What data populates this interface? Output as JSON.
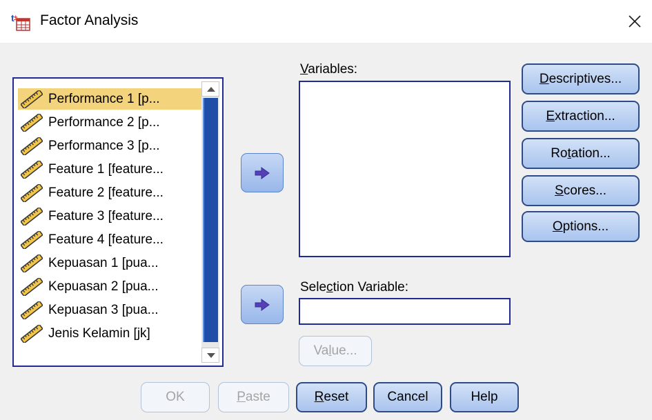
{
  "window": {
    "title": "Factor Analysis",
    "app_icon": "spss-table-icon",
    "close_glyph": "×"
  },
  "variables_list": [
    {
      "label": "Performance 1 [p...",
      "icon": "scale-ruler-icon",
      "selected": true
    },
    {
      "label": "Performance 2 [p...",
      "icon": "scale-ruler-icon",
      "selected": false
    },
    {
      "label": "Performance 3 [p...",
      "icon": "scale-ruler-icon",
      "selected": false
    },
    {
      "label": "Feature 1 [feature...",
      "icon": "scale-ruler-icon",
      "selected": false
    },
    {
      "label": "Feature 2 [feature...",
      "icon": "scale-ruler-icon",
      "selected": false
    },
    {
      "label": "Feature 3 [feature...",
      "icon": "scale-ruler-icon",
      "selected": false
    },
    {
      "label": "Feature 4 [feature...",
      "icon": "scale-ruler-icon",
      "selected": false
    },
    {
      "label": "Kepuasan 1 [pua...",
      "icon": "scale-ruler-icon",
      "selected": false
    },
    {
      "label": "Kepuasan 2 [pua...",
      "icon": "scale-ruler-icon",
      "selected": false
    },
    {
      "label": "Kepuasan 3 [pua...",
      "icon": "scale-ruler-icon",
      "selected": false
    },
    {
      "label": "Jenis Kelamin [jk]",
      "icon": "scale-ruler-icon",
      "selected": false
    }
  ],
  "variables_box": {
    "label_underlined": "V",
    "label_rest": "ariables:"
  },
  "selection_variable": {
    "label_before": "Sele",
    "label_underlined": "c",
    "label_after": "tion Variable:",
    "value": ""
  },
  "value_button": {
    "before": "Va",
    "underlined": "l",
    "after": "ue...",
    "enabled": false
  },
  "side_buttons": {
    "descriptives": {
      "before": "",
      "underlined": "D",
      "after": "escriptives..."
    },
    "extraction": {
      "before": "",
      "underlined": "E",
      "after": "xtraction..."
    },
    "rotation": {
      "before": "Ro",
      "underlined": "t",
      "after": "ation..."
    },
    "scores": {
      "before": "",
      "underlined": "S",
      "after": "cores..."
    },
    "options": {
      "before": "",
      "underlined": "O",
      "after": "ptions..."
    }
  },
  "bottom_buttons": {
    "ok": {
      "label": "OK",
      "enabled": false
    },
    "paste": {
      "underlined": "P",
      "after": "aste",
      "enabled": false
    },
    "reset": {
      "underlined": "R",
      "after": "eset",
      "enabled": true
    },
    "cancel": {
      "label": "Cancel",
      "enabled": true
    },
    "help": {
      "label": "Help",
      "enabled": true
    }
  },
  "colors": {
    "selection_highlight": "#f3d37b",
    "list_border": "#1f2a96",
    "button_fill": "#b8cff1",
    "scroll_thumb": "#1f4ea8"
  }
}
